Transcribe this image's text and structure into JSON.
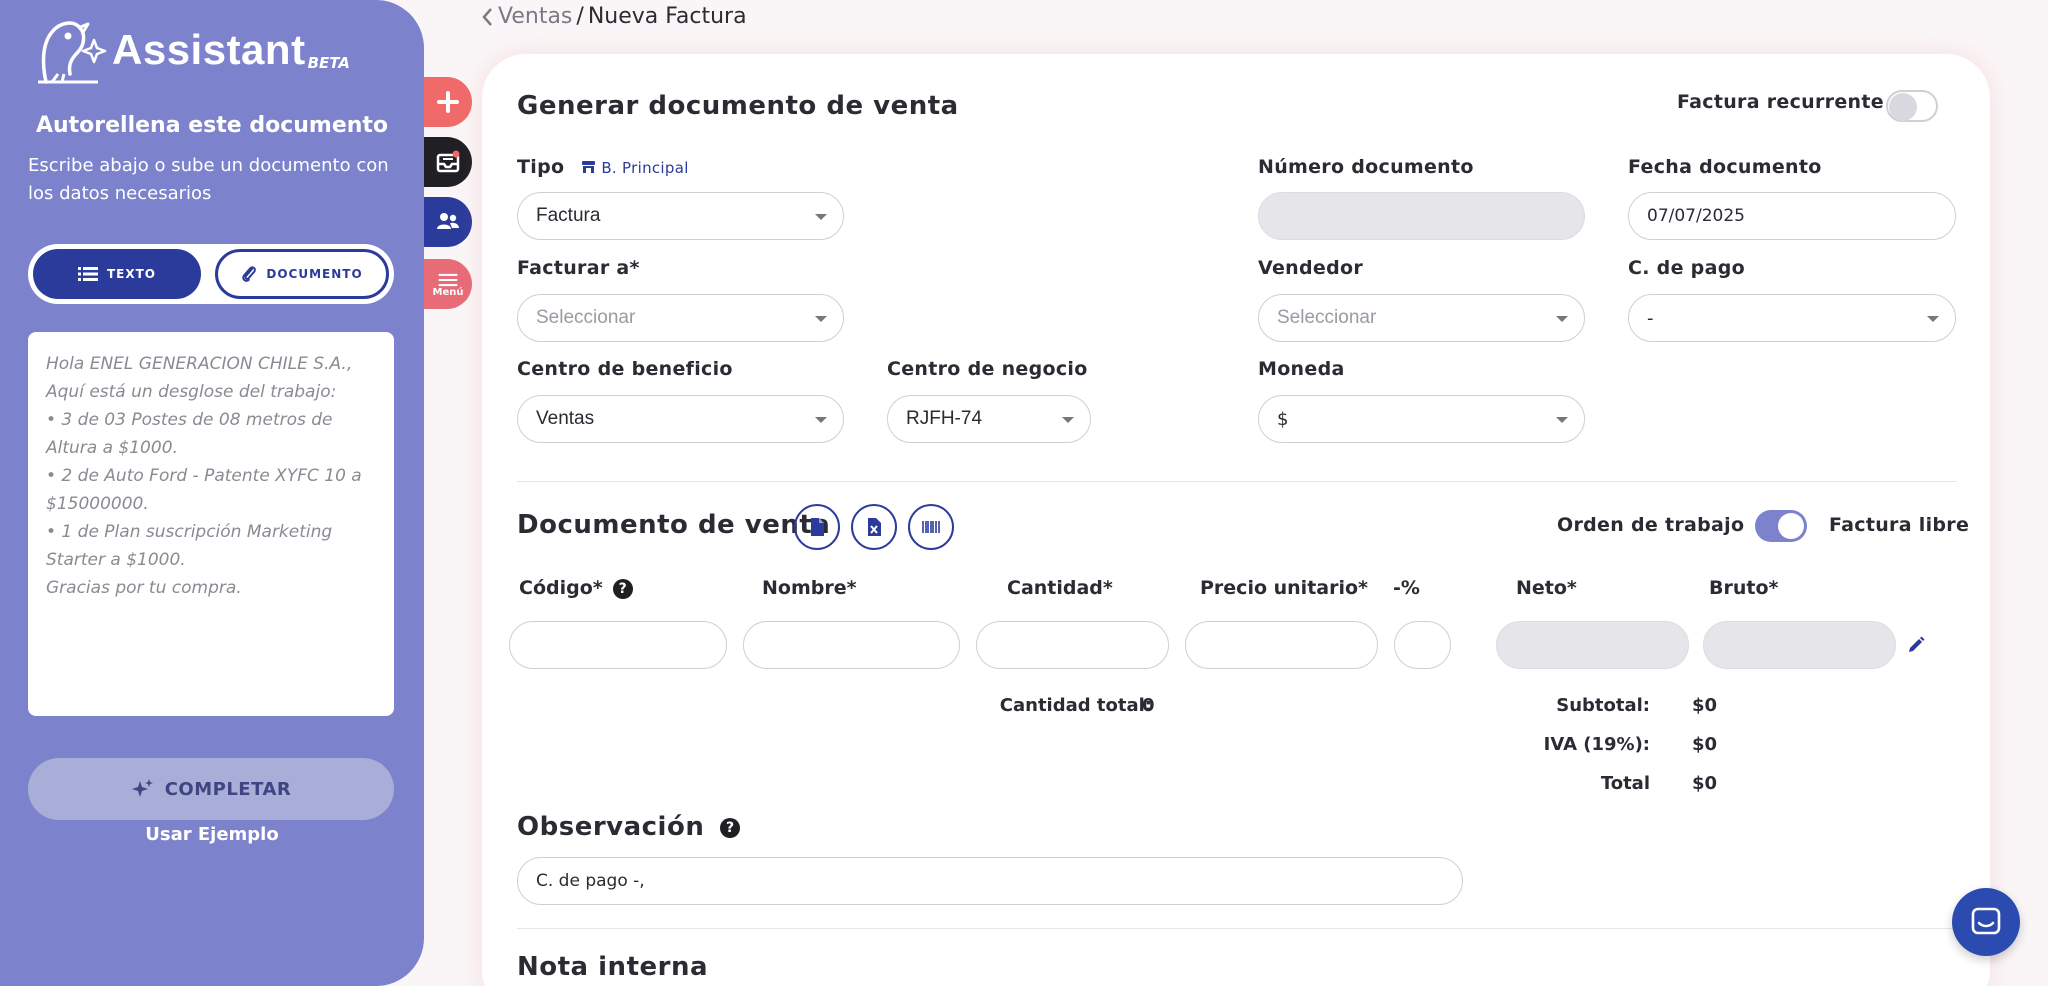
{
  "assistant": {
    "logo_text": "Assistant",
    "logo_beta": "BETA",
    "title": "Autorellena este documento",
    "description": "Escribe abajo o sube un documento con los datos necesarios",
    "mode_text": "TEXTO",
    "mode_document": "DOCUMENTO",
    "example_lines": [
      "Hola ENEL GENERACION CHILE S.A.,",
      "Aquí está un desglose del trabajo:",
      "• 3 de 03 Postes de 08 metros de Altura a $1000.",
      "• 2 de Auto Ford - Patente XYFC 10 a $15000000.",
      "• 1 de Plan suscripción Marketing Starter a $1000.",
      "Gracias por tu compra."
    ],
    "complete_label": "COMPLETAR",
    "use_example": "Usar Ejemplo"
  },
  "quick_menu": {
    "menu_label": "Menú"
  },
  "breadcrumb": {
    "parent": "Ventas",
    "separator": "/",
    "current": "Nueva Factura"
  },
  "header": {
    "title": "Generar documento de venta",
    "recurrent_label": "Factura recurrente",
    "recurrent_on": false
  },
  "form": {
    "tipo_label": "Tipo",
    "tipo_badge": "B. Principal",
    "tipo_value": "Factura",
    "numero_label": "Número documento",
    "numero_value": "",
    "fecha_label": "Fecha documento",
    "fecha_value": "07/07/2025",
    "facturar_label": "Facturar a*",
    "facturar_value": "Seleccionar",
    "vendedor_label": "Vendedor",
    "vendedor_value": "Seleccionar",
    "cpago_label": "C. de pago",
    "cpago_value": "-",
    "beneficio_label": "Centro de beneficio",
    "beneficio_value": "Ventas",
    "negocio_label": "Centro de negocio",
    "negocio_value": "RJFH-74",
    "moneda_label": "Moneda",
    "moneda_value": "$"
  },
  "sale_doc": {
    "title": "Documento de venta",
    "orden_label": "Orden de trabajo",
    "libre_label": "Factura libre",
    "toggle_on": true,
    "columns": {
      "codigo": "Código*",
      "nombre": "Nombre*",
      "cantidad": "Cantidad*",
      "precio": "Precio unitario*",
      "descuento": "-%",
      "neto": "Neto*",
      "bruto": "Bruto*"
    },
    "cantidad_total_label": "Cantidad total:",
    "cantidad_total_value": "0",
    "subtotal_label": "Subtotal:",
    "subtotal_value": "$0",
    "iva_label": "IVA (19%):",
    "iva_value": "$0",
    "total_label": "Total",
    "total_value": "$0"
  },
  "observacion": {
    "title": "Observación",
    "value": "C. de pago -,"
  },
  "nota": {
    "title": "Nota interna"
  },
  "colors": {
    "assistant_bg": "#7c83cc",
    "primary": "#2b3b9b",
    "accent_red": "#f06a6a"
  }
}
